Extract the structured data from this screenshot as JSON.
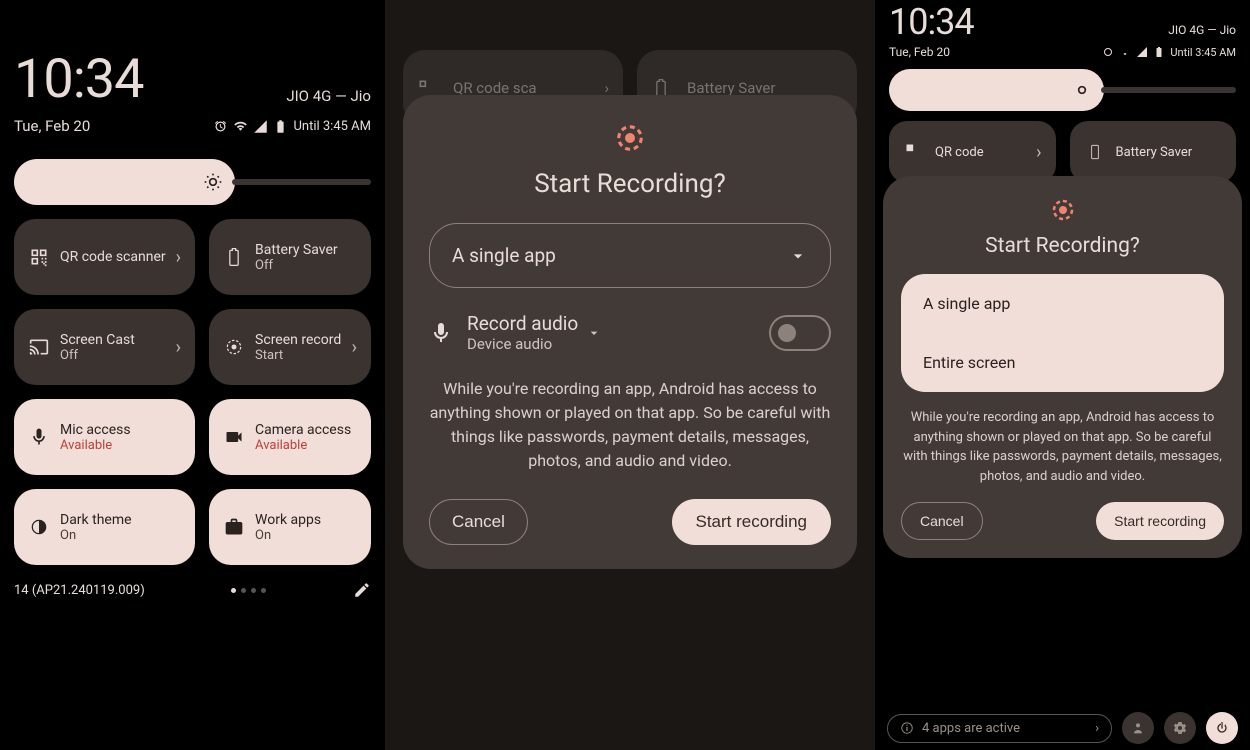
{
  "panel1": {
    "clock": "10:34",
    "carrier": "JIO 4G — Jio",
    "date": "Tue, Feb 20",
    "until": "Until 3:45 AM",
    "tiles": [
      {
        "title": "QR code scanner",
        "sub": "",
        "chevron": "›"
      },
      {
        "title": "Battery Saver",
        "sub": "Off"
      },
      {
        "title": "Screen Cast",
        "sub": "Off",
        "chevron": "›"
      },
      {
        "title": "Screen record",
        "sub": "Start",
        "chevron": "›"
      },
      {
        "title": "Mic access",
        "sub": "Available"
      },
      {
        "title": "Camera access",
        "sub": "Available"
      },
      {
        "title": "Dark theme",
        "sub": "On"
      },
      {
        "title": "Work apps",
        "sub": "On"
      }
    ],
    "build": "14 (AP21.240119.009)"
  },
  "panel2": {
    "bg_tiles": {
      "qr": "QR code sca",
      "battery": "Battery Saver"
    },
    "dialog_title": "Start Recording?",
    "dropdown": "A single app",
    "audio_title": "Record audio",
    "audio_sub": "Device audio",
    "warning": "While you're recording an app, Android has access to anything shown or played on that app. So be careful with things like passwords, payment details, messages, photos, and audio and video.",
    "cancel": "Cancel",
    "start": "Start recording"
  },
  "panel3": {
    "clock": "10:34",
    "carrier": "JIO 4G — Jio",
    "date": "Tue, Feb 20",
    "until": "Until 3:45 AM",
    "bg_tiles": {
      "qr": "QR code",
      "battery": "Battery Saver"
    },
    "dialog_title": "Start Recording?",
    "options": [
      "A single app",
      "Entire screen"
    ],
    "warning": "While you're recording an app, Android has access to anything shown or played on that app. So be careful with things like passwords, payment details, messages, photos, and audio and video.",
    "cancel": "Cancel",
    "start": "Start recording",
    "bottom": "4 apps are active"
  }
}
